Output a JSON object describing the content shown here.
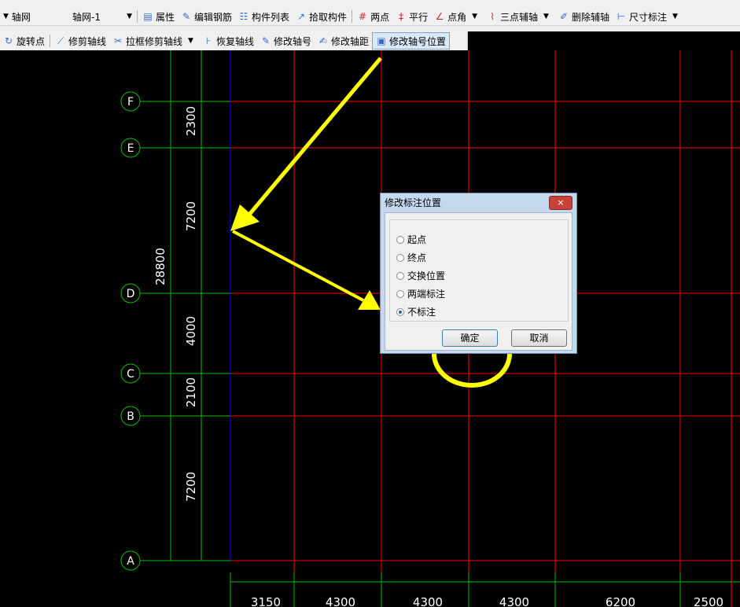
{
  "toolbar1": {
    "combo_type": "轴网",
    "combo_item": "轴网-1",
    "buttons": [
      "属性",
      "编辑钢筋",
      "构件列表",
      "拾取构件",
      "两点",
      "平行",
      "点角",
      "三点辅轴",
      "删除辅轴",
      "尺寸标注"
    ]
  },
  "toolbar2": {
    "buttons": [
      "旋转点",
      "修剪轴线",
      "拉框修剪轴线",
      "恢复轴线",
      "修改轴号",
      "修改轴距",
      "修改轴号位置"
    ]
  },
  "axes": {
    "rows": [
      {
        "label": "F",
        "spacing_below": "2300"
      },
      {
        "label": "E",
        "spacing_below": "7200"
      },
      {
        "label": "D",
        "spacing_below": "4000"
      },
      {
        "label": "C",
        "spacing_below": "2100"
      },
      {
        "label": "B",
        "spacing_below": "7200"
      },
      {
        "label": "A",
        "spacing_below": ""
      }
    ],
    "total_height": "28800",
    "column_spacings": [
      "3150",
      "4300",
      "4300",
      "4300",
      "6200",
      "2500"
    ]
  },
  "dialog": {
    "title": "修改标注位置",
    "close_label": "×",
    "options": [
      {
        "label": "起点",
        "selected": false
      },
      {
        "label": "终点",
        "selected": false
      },
      {
        "label": "交换位置",
        "selected": false
      },
      {
        "label": "两端标注",
        "selected": false
      },
      {
        "label": "不标注",
        "selected": true
      }
    ],
    "ok_label": "确定",
    "cancel_label": "取消"
  },
  "colors": {
    "grid_red": "#ff0000",
    "grid_green": "#00c000",
    "axis_blue": "#0000ff",
    "annotation_yellow": "#ffff00"
  }
}
